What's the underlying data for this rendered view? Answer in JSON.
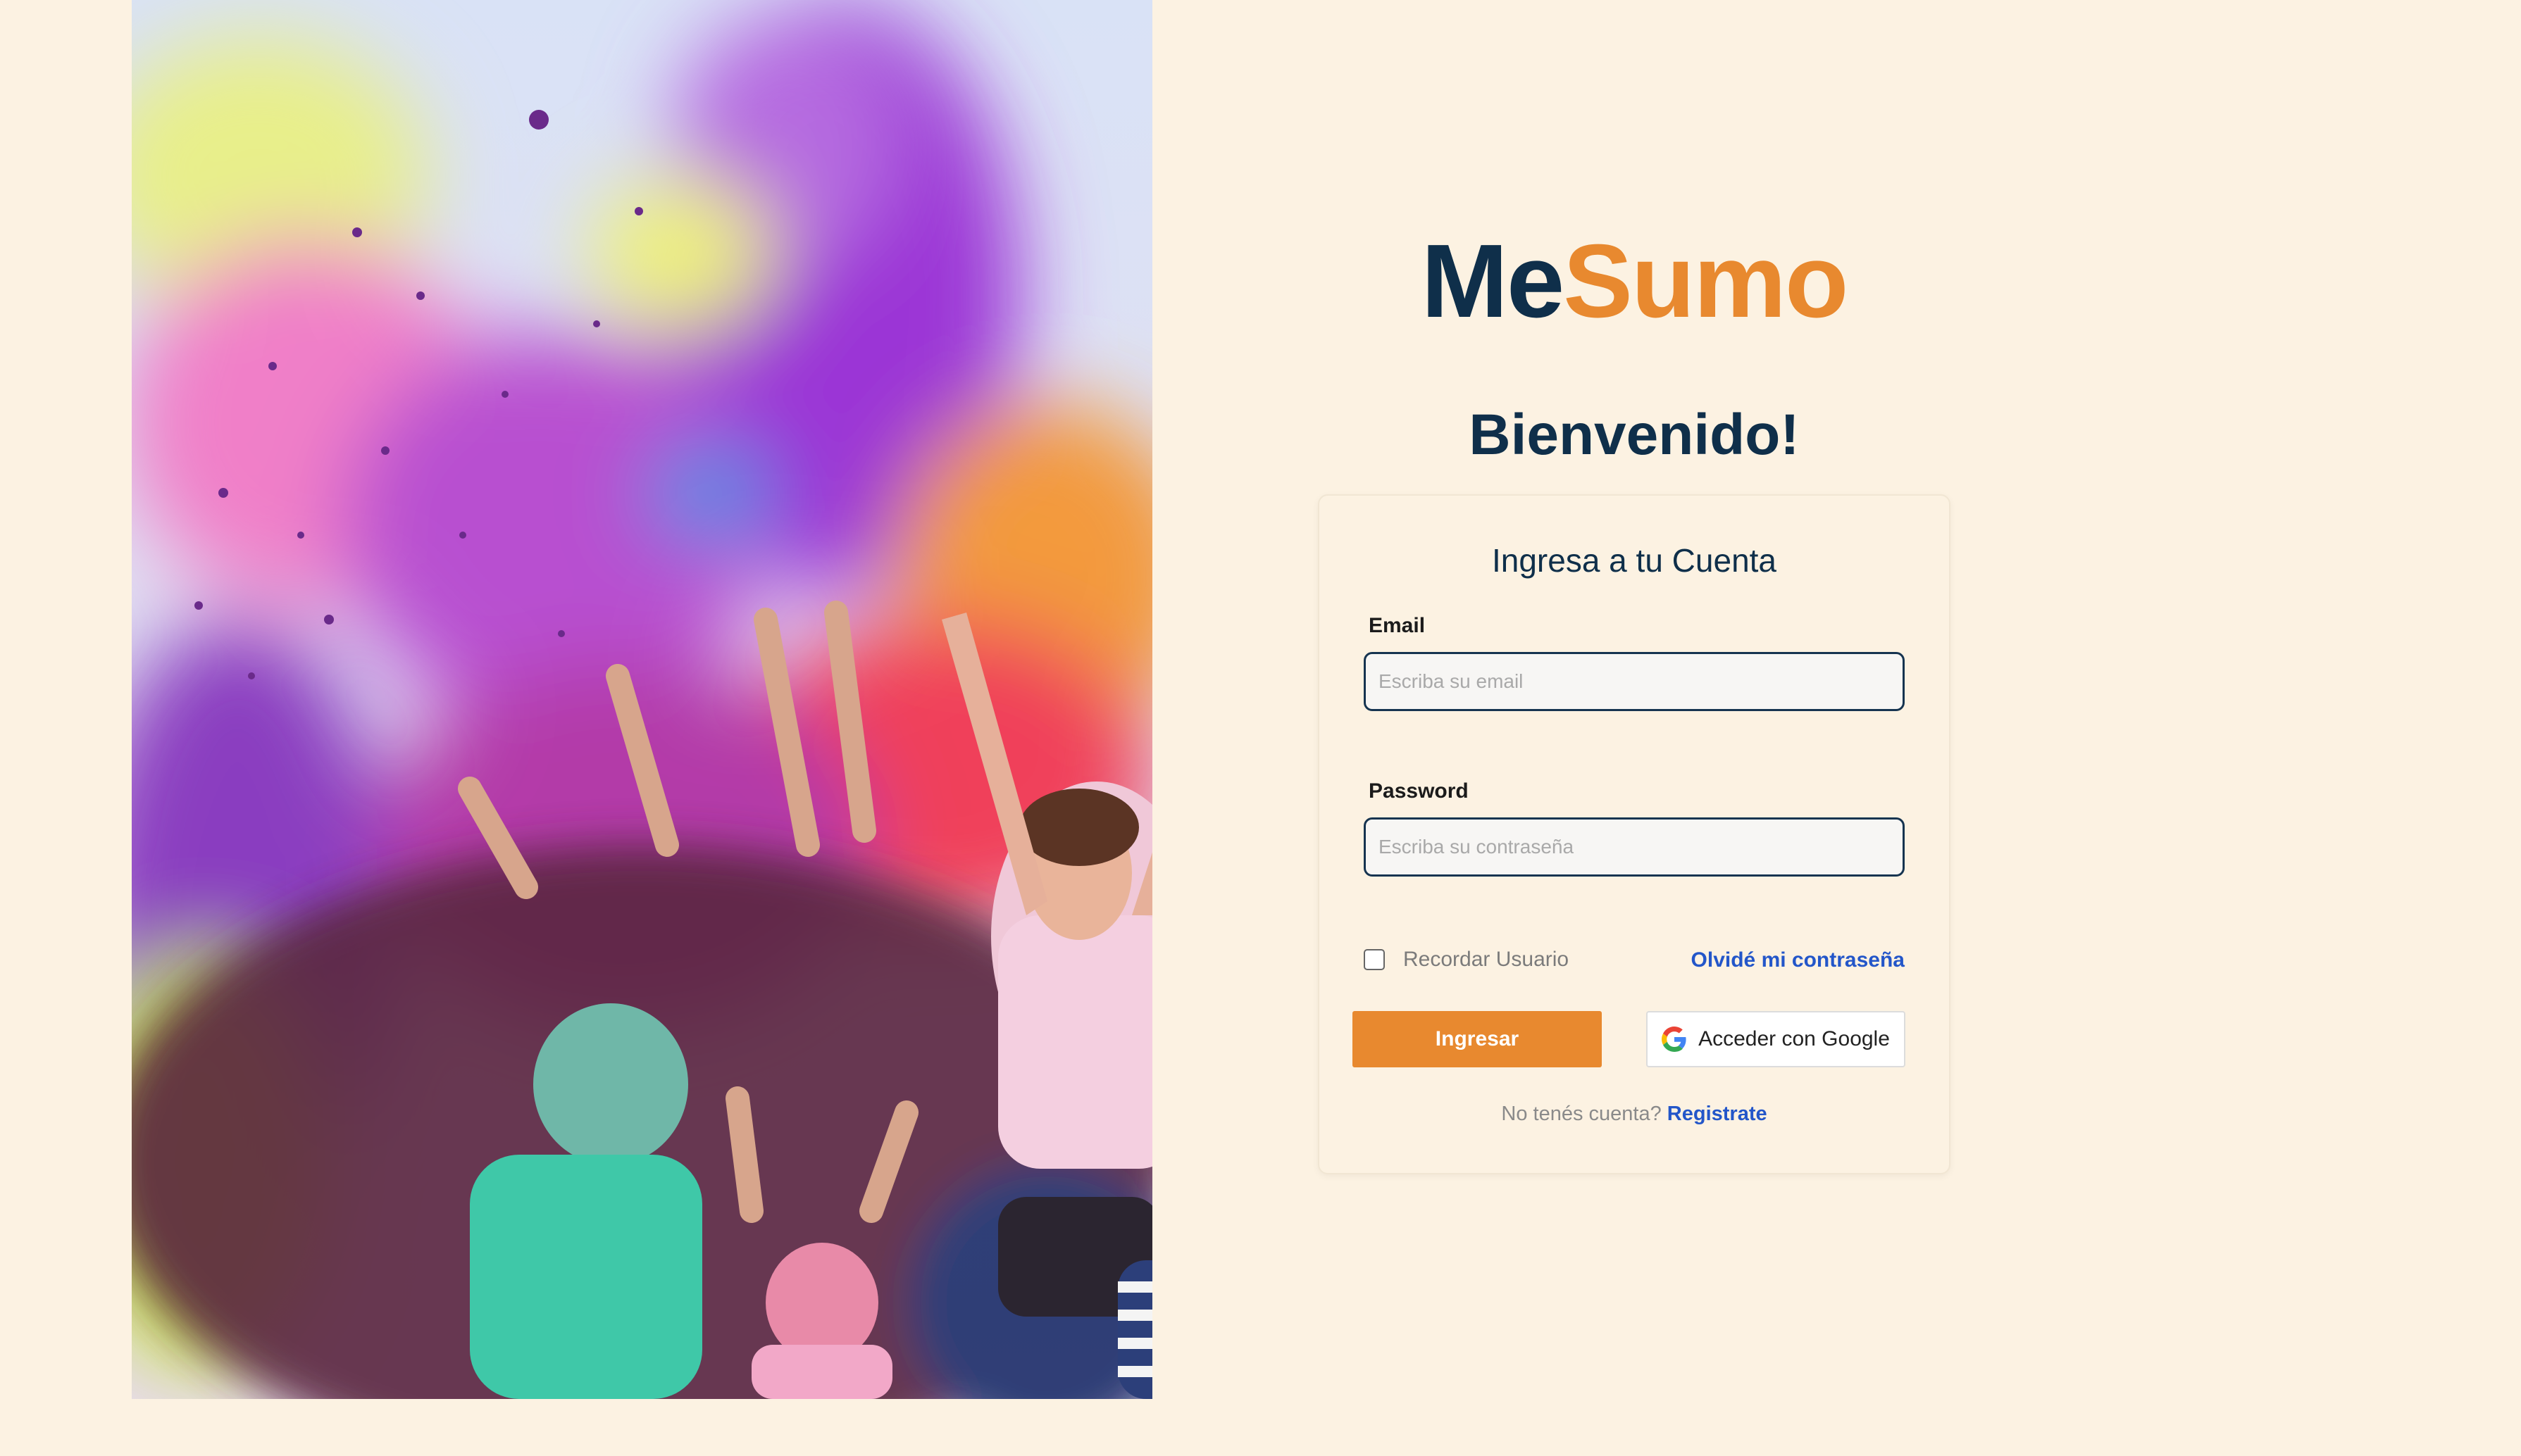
{
  "brand": {
    "part1": "Me",
    "part2": "Sumo",
    "color_dark": "#0f2f4a",
    "color_accent": "#e8892f"
  },
  "hero": {
    "image": "colorful-holi-powder-crowd-photo"
  },
  "welcome_title": "Bienvenido!",
  "login_card": {
    "title": "Ingresa a tu Cuenta",
    "email": {
      "label": "Email",
      "value": "",
      "placeholder": "Escriba su email"
    },
    "password": {
      "label": "Password",
      "value": "",
      "placeholder": "Escriba su contraseña"
    },
    "remember": {
      "label": "Recordar Usuario",
      "checked": false
    },
    "forgot_link": "Olvidé mi contraseña",
    "submit_button": "Ingresar",
    "google_button": {
      "label": "Acceder con Google",
      "icon": "google-g-icon"
    },
    "register": {
      "prompt": "No tenés cuenta?",
      "link": "Registrate"
    }
  },
  "colors": {
    "background": "#fcf2e2",
    "link": "#2356c9",
    "button_primary": "#e8892f"
  }
}
